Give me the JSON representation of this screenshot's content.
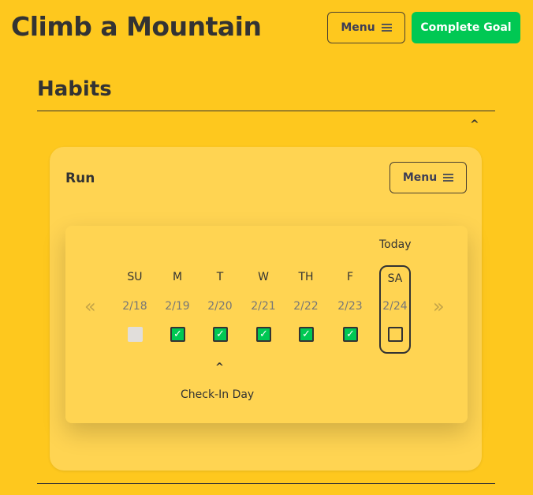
{
  "header": {
    "title": "Climb a Mountain",
    "menu_label": "Menu",
    "complete_label": "Complete Goal"
  },
  "section": {
    "title": "Habits",
    "collapse_icon": "^"
  },
  "habit": {
    "name": "Run",
    "menu_label": "Menu",
    "today_label": "Today",
    "checkin_label": "Check-In Day",
    "checkin_caret": "^",
    "prev": "«",
    "next": "»",
    "days": [
      {
        "name": "SU",
        "date": "2/18",
        "state": "disabled"
      },
      {
        "name": "M",
        "date": "2/19",
        "state": "checked"
      },
      {
        "name": "T",
        "date": "2/20",
        "state": "checked"
      },
      {
        "name": "W",
        "date": "2/21",
        "state": "checked"
      },
      {
        "name": "TH",
        "date": "2/22",
        "state": "checked"
      },
      {
        "name": "F",
        "date": "2/23",
        "state": "checked"
      },
      {
        "name": "SA",
        "date": "2/24",
        "state": "unchecked"
      }
    ]
  },
  "colors": {
    "background": "#fec81e",
    "card": "#ffd452",
    "accent": "#00c853"
  }
}
